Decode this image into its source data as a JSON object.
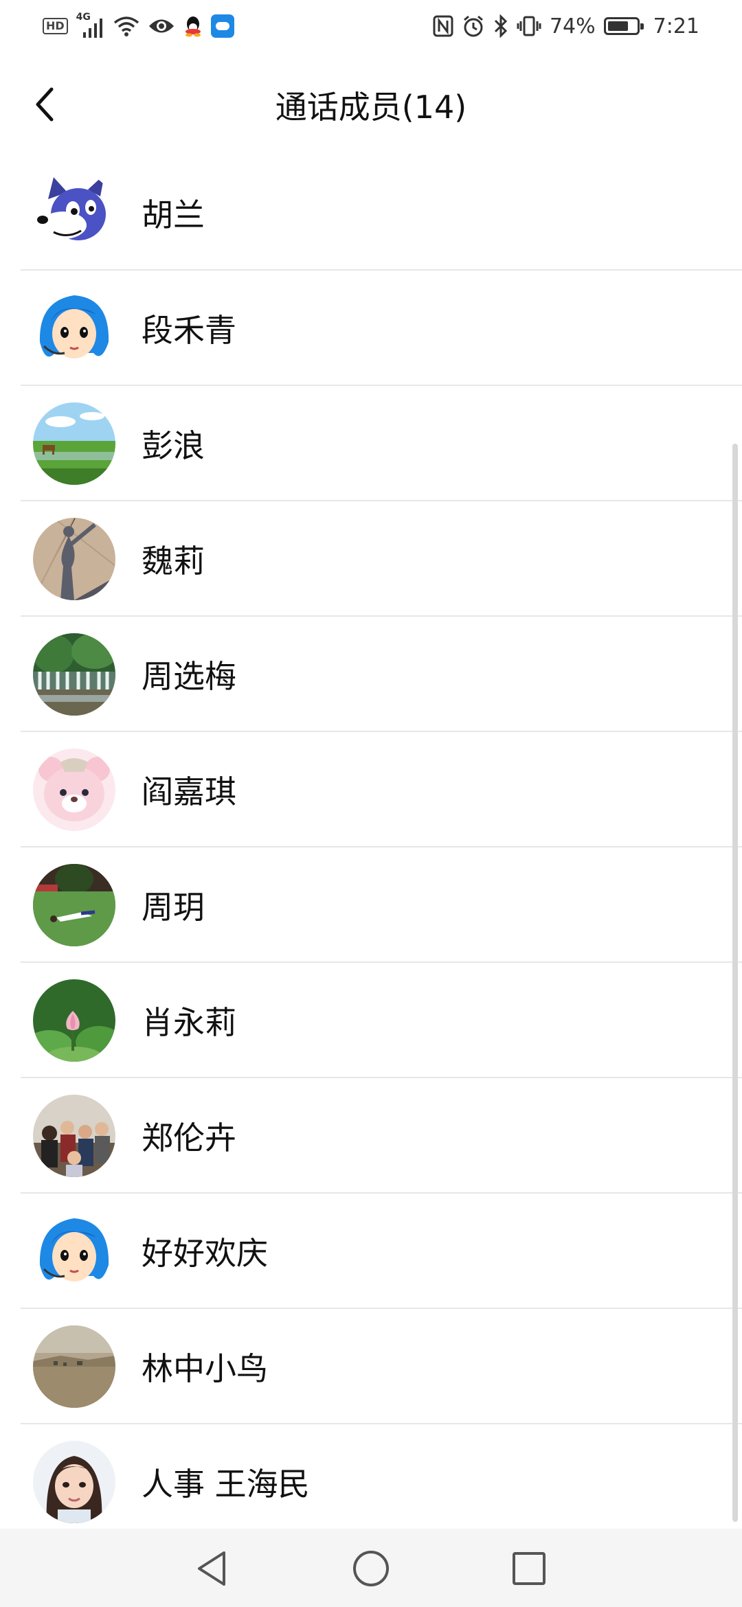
{
  "status_bar": {
    "network": "4G",
    "battery_percent": "74%",
    "battery_level": 0.74,
    "time": "7:21",
    "icons": [
      "hd-icon",
      "signal-icon",
      "wifi-icon",
      "eye-icon",
      "qq-icon",
      "weather-app-icon",
      "nfc-icon",
      "alarm-icon",
      "bluetooth-icon",
      "vibrate-icon",
      "battery-icon"
    ]
  },
  "header": {
    "title": "通话成员(14)",
    "back_icon": "back-arrow-icon"
  },
  "members": [
    {
      "name": "胡兰",
      "avatar": "cartoon-wolf"
    },
    {
      "name": "段禾青",
      "avatar": "anime-girl-blue-hair"
    },
    {
      "name": "彭浪",
      "avatar": "grassland-deer"
    },
    {
      "name": "魏莉",
      "avatar": "shadow-on-ground"
    },
    {
      "name": "周选梅",
      "avatar": "waterfall"
    },
    {
      "name": "阎嘉琪",
      "avatar": "pink-bear"
    },
    {
      "name": "周玥",
      "avatar": "person-on-lawn"
    },
    {
      "name": "肖永莉",
      "avatar": "lotus-flower"
    },
    {
      "name": "郑伦卉",
      "avatar": "group-photo"
    },
    {
      "name": "好好欢庆",
      "avatar": "anime-girl-blue-hair"
    },
    {
      "name": "林中小鸟",
      "avatar": "desert-landscape"
    },
    {
      "name": "人事 王海民",
      "avatar": "child-portrait"
    }
  ],
  "nav": {
    "back": "nav-back-icon",
    "home": "nav-home-icon",
    "recents": "nav-recents-icon"
  }
}
